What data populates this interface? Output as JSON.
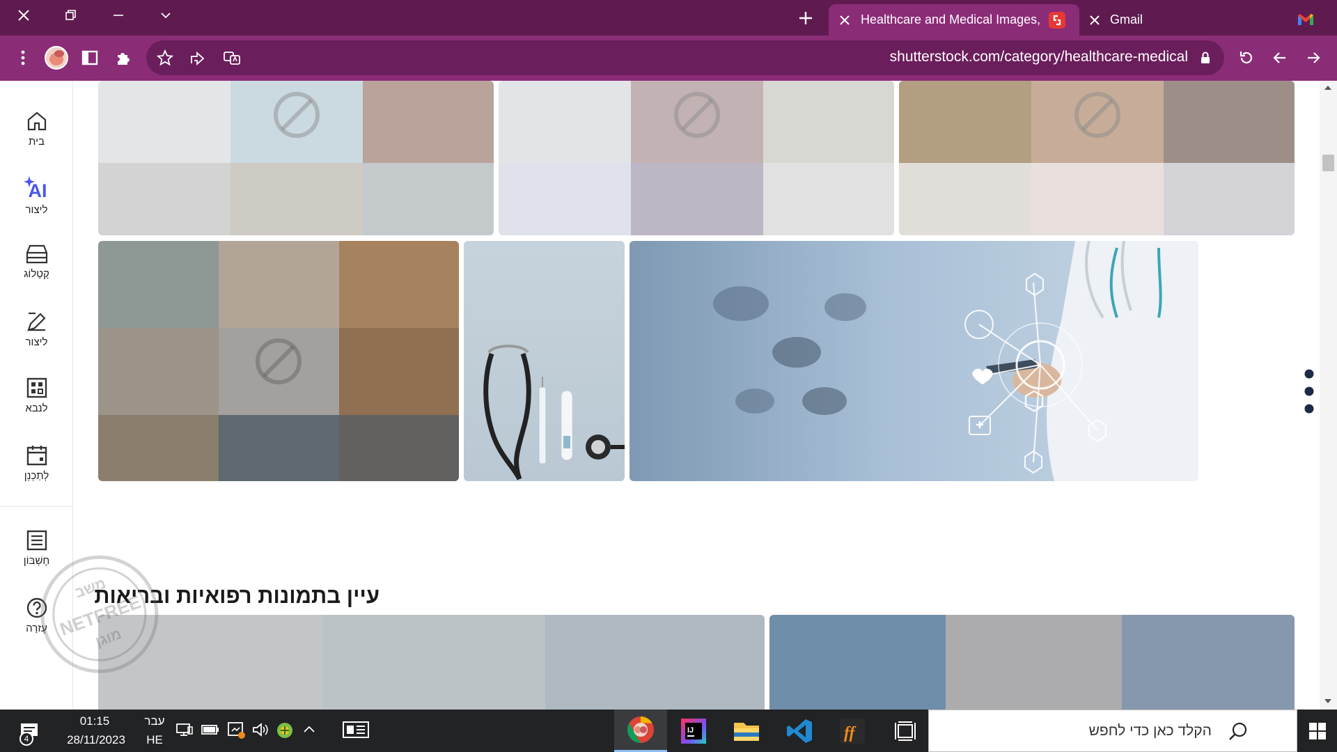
{
  "browser": {
    "tabs": [
      {
        "title": "Healthcare and Medical Images,",
        "active": true
      },
      {
        "title": "Gmail",
        "active": false
      }
    ],
    "url": "shutterstock.com/category/healthcare-medical"
  },
  "sidebar": {
    "items": [
      {
        "label": "בית",
        "icon": "home-icon"
      },
      {
        "label": "ליצור",
        "icon": "ai-icon",
        "badge": "AI"
      },
      {
        "label": "קָטָלוֹג",
        "icon": "catalog-icon"
      },
      {
        "label": "ליצור",
        "icon": "edit-icon"
      },
      {
        "label": "לנבא",
        "icon": "dashboard-icon"
      },
      {
        "label": "לְתַכְנֵן",
        "icon": "calendar-icon"
      },
      {
        "label": "חֶשְׁבּוֹן",
        "icon": "list-icon"
      },
      {
        "label": "עֶזרָה",
        "icon": "help-icon"
      }
    ]
  },
  "content": {
    "section_heading": "עיין בתמונות רפואיות ובריאות"
  },
  "watermark": {
    "lines": [
      "משב",
      "NETFREE",
      "מוגן"
    ]
  },
  "taskbar": {
    "notification_count": "4",
    "time": "01:15",
    "date": "28/11/2023",
    "language_top": "עבר",
    "language_bottom": "HE",
    "search_placeholder": "הקלד כאן כדי לחפש"
  },
  "colors": {
    "titlebar": "#5f1b4f",
    "toolbar": "#8b2c77",
    "accent_ai": "#4a57e6"
  }
}
